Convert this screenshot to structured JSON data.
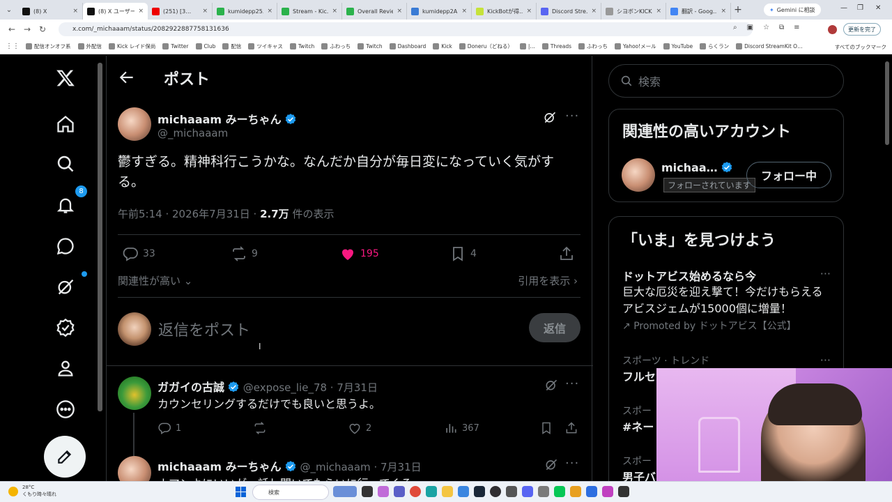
{
  "browser": {
    "tabs": [
      {
        "label": "(8) X",
        "color": "#111"
      },
      {
        "label": "(8) X ユーザーの…",
        "color": "#111",
        "active": true
      },
      {
        "label": "(251) [3…",
        "color": "#e00"
      },
      {
        "label": "kumidepp25…",
        "color": "#2bb24c"
      },
      {
        "label": "Stream - Kic…",
        "color": "#2bb24c"
      },
      {
        "label": "Overall Revie…",
        "color": "#2bb24c"
      },
      {
        "label": "kumidepp2A…",
        "color": "#3a7bd5"
      },
      {
        "label": "KickBotが得…",
        "color": "#c6e23a"
      },
      {
        "label": "Discord Stre…",
        "color": "#5865f2"
      },
      {
        "label": "シヨボンKICK…",
        "color": "#999"
      },
      {
        "label": "翻訳 - Goog…",
        "color": "#4285f4"
      }
    ],
    "gemini_label": "Gemini に相談",
    "url": "x.com/_michaaam/status/2082922887758131636",
    "update_label": "更新を完了",
    "bookmarks": [
      "配信オンオフ系",
      "外配信",
      "Kick レイド保尚",
      "Twitter",
      "Club",
      "配信",
      "ツイキャス",
      "Twitch",
      "ふわっち",
      "Twitch",
      "Dashboard",
      "Kick",
      "Doneru（どねる）",
      "|…",
      "Threads",
      "ふわっち",
      "Yahoo!メール",
      "YouTube",
      "らくラン",
      "Discord StreamKit O…"
    ],
    "all_bookmarks": "すべてのブックマーク"
  },
  "nav": {
    "notifications_badge": "8"
  },
  "main": {
    "title": "ポスト",
    "author": {
      "name": "michaaam みーちゃん",
      "handle": "@_michaaam"
    },
    "text": "鬱すぎる。精神科行こうかな。なんだか自分が毎日変になっていく気がする。",
    "meta_time": "午前5:14 · 2026年7月31日 · ",
    "meta_views": "2.7万",
    "meta_views_suffix": " 件の表示",
    "actions": {
      "replies": "33",
      "reposts": "9",
      "likes": "195",
      "bookmarks": "4"
    },
    "sort_label": "関連性が高い",
    "quotes_label": "引用を表示",
    "reply_placeholder": "返信をポスト",
    "reply_button": "返信",
    "replies": [
      {
        "name": "ガガイの古誠",
        "handle": "@expose_lie_78",
        "date": "7月31日",
        "text": "カウンセリングするだけでも良いと思うよ。",
        "replies": "1",
        "reposts": "",
        "likes": "2",
        "views": "367"
      },
      {
        "name": "michaaam みーちゃん",
        "handle": "@_michaaam",
        "date": "7月31日",
        "text": "ナマンよにいいがっ話し聞いてもらいに行ってくる"
      }
    ]
  },
  "right": {
    "search_placeholder": "検索",
    "related_title": "関連性の高いアカウント",
    "related_name": "michaa…",
    "related_tooltip": "フォローされています",
    "follow_label": "フォロー中",
    "trends_title": "「いま」を見つけよう",
    "promo": {
      "title": "ドットアビス始めるなら今",
      "desc": "巨大な厄災を迎え撃て！今だけもらえるアビスジェムが15000個に増量！",
      "promoted": "Promoted by ドットアビス【公式】"
    },
    "trend1_cat": "スポーツ · トレンド",
    "trend1_title": "フルセ",
    "trend2_cat": "スポー",
    "trend2_title": "#ネー",
    "trend3_cat": "スポー",
    "trend3_title": "男子バ"
  },
  "taskbar": {
    "temp": "28°C",
    "weather": "くもり時々晴れ",
    "search": "検索"
  },
  "colors": {
    "accent": "#1d9bf0",
    "like": "#f91880",
    "background": "#000000",
    "muted": "#71767b"
  }
}
